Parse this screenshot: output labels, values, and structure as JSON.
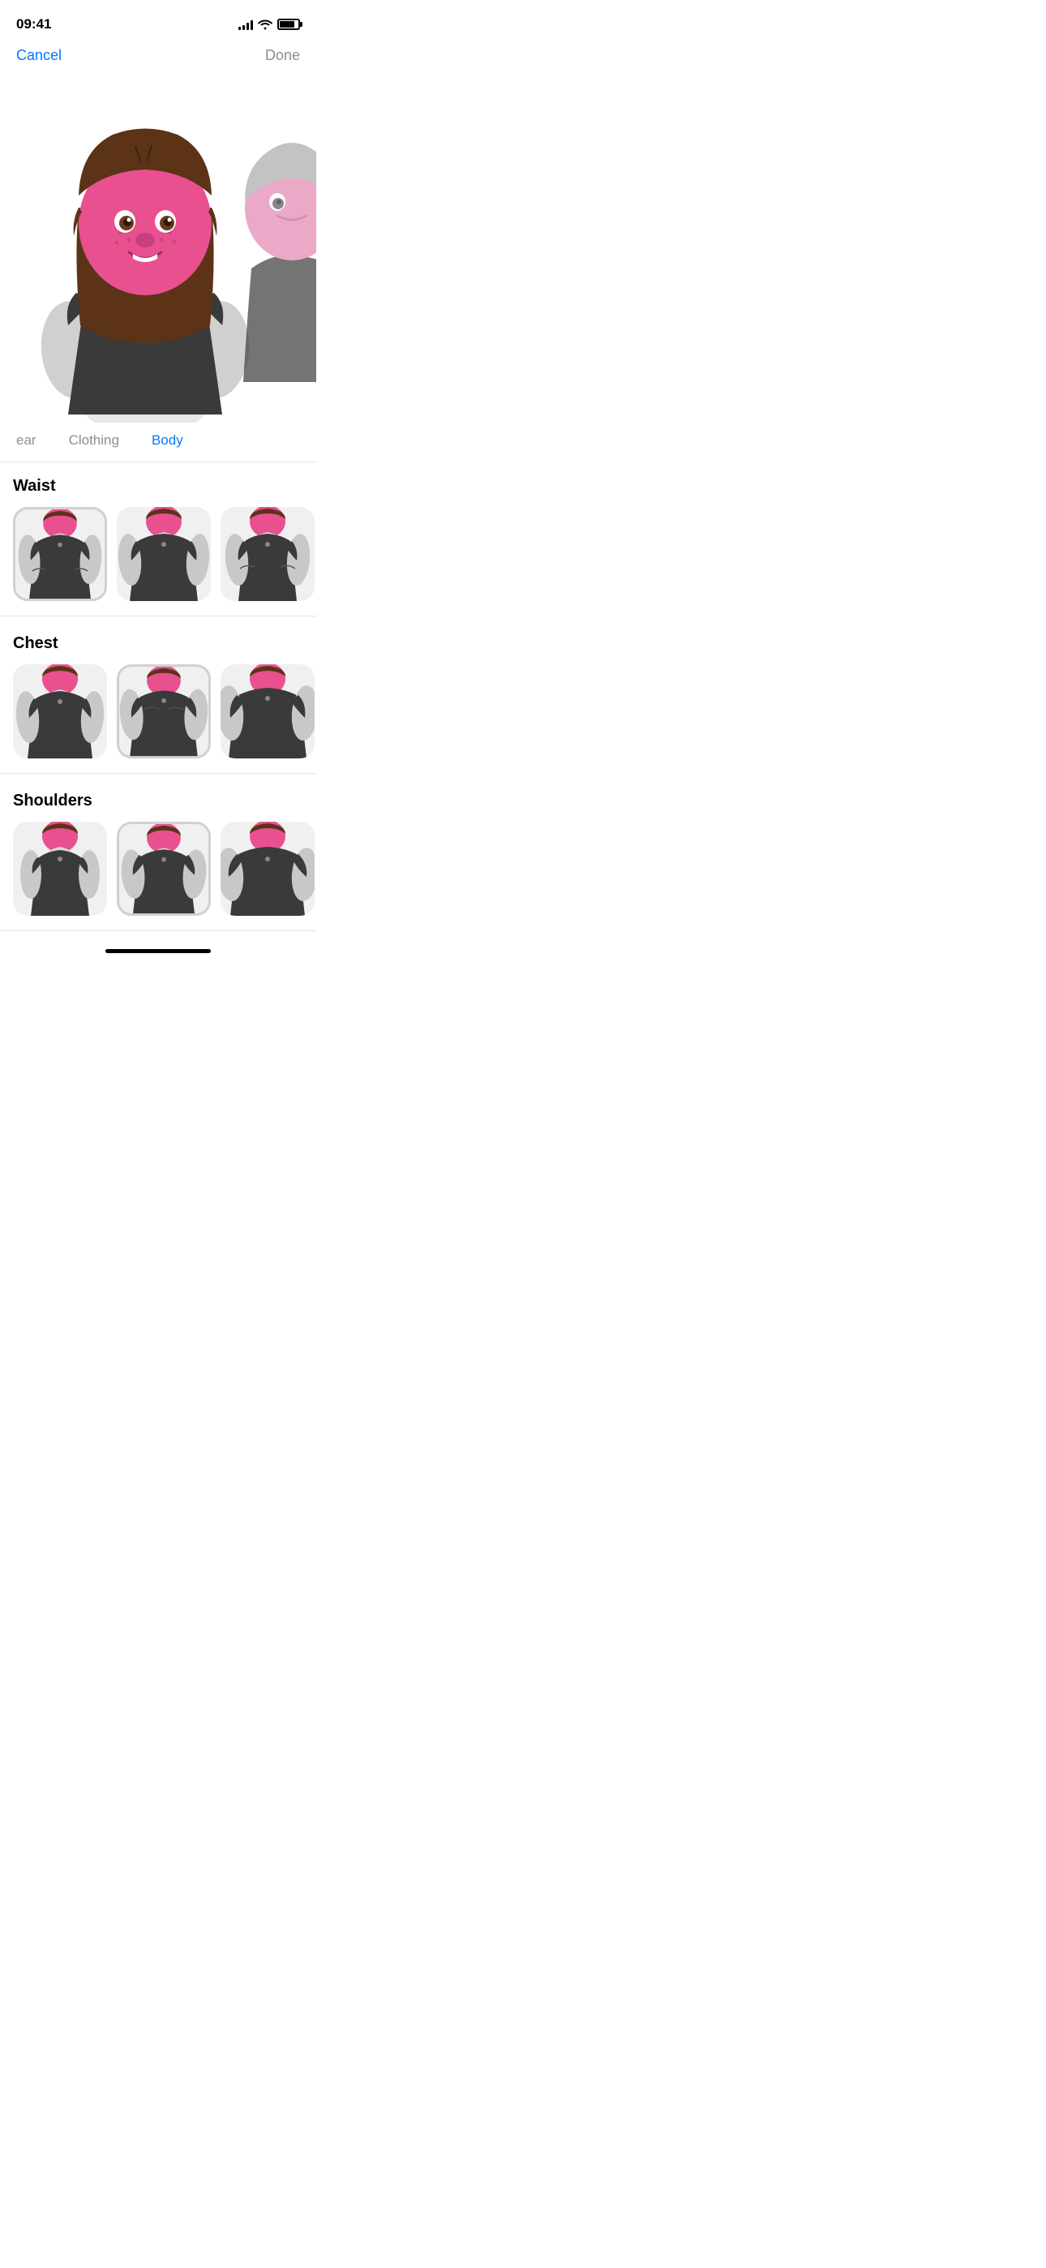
{
  "statusBar": {
    "time": "09:41",
    "signalBars": [
      4,
      6,
      8,
      10,
      12
    ],
    "batteryPercent": 80
  },
  "nav": {
    "cancelLabel": "Cancel",
    "doneLabel": "Done"
  },
  "tabs": [
    {
      "id": "headwear",
      "label": "ear"
    },
    {
      "id": "clothing",
      "label": "Clothing"
    },
    {
      "id": "body",
      "label": "Body",
      "active": true
    }
  ],
  "sections": [
    {
      "id": "waist",
      "title": "Waist",
      "options": [
        {
          "id": "w1",
          "selected": true
        },
        {
          "id": "w2",
          "selected": false
        },
        {
          "id": "w3",
          "selected": false
        }
      ]
    },
    {
      "id": "chest",
      "title": "Chest",
      "options": [
        {
          "id": "c1",
          "selected": false
        },
        {
          "id": "c2",
          "selected": true
        },
        {
          "id": "c3",
          "selected": false
        }
      ]
    },
    {
      "id": "shoulders",
      "title": "Shoulders",
      "options": [
        {
          "id": "s1",
          "selected": false
        },
        {
          "id": "s2",
          "selected": true
        },
        {
          "id": "s3",
          "selected": false
        }
      ]
    }
  ],
  "homeIndicator": true
}
